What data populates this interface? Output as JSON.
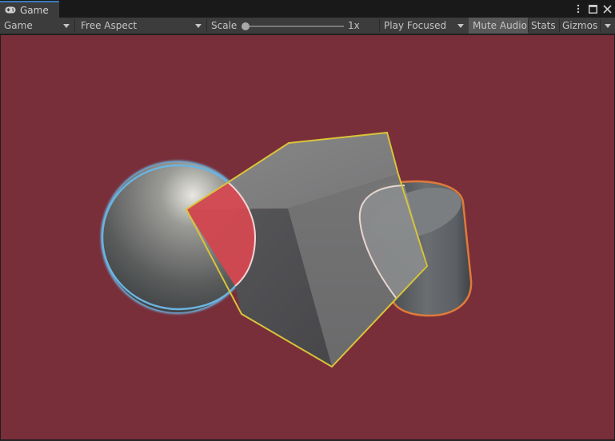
{
  "window": {
    "tab_label": "Game",
    "tab_icon": "gamepad-icon",
    "controls": [
      "more-options-icon",
      "maximize-icon",
      "close-icon"
    ]
  },
  "toolbar": {
    "display_dropdown": "Game",
    "aspect_dropdown": "Free Aspect",
    "scale_label": "Scale",
    "scale_value": "1x",
    "scale_level": 0,
    "play_mode_dropdown": "Play Focused",
    "mute_audio_label": "Mute Audio",
    "mute_audio_on": true,
    "stats_label": "Stats",
    "gizmos_label": "Gizmos"
  },
  "scene": {
    "background_color": "#782f3a",
    "objects": [
      "sphere",
      "cube",
      "cylinder"
    ],
    "sphere_outline_color": "#6ab4e0",
    "cube_outline_color": "#d8c43a",
    "cylinder_outline_color": "#e07a3a",
    "overlap_highlight_color": "#d84850"
  }
}
